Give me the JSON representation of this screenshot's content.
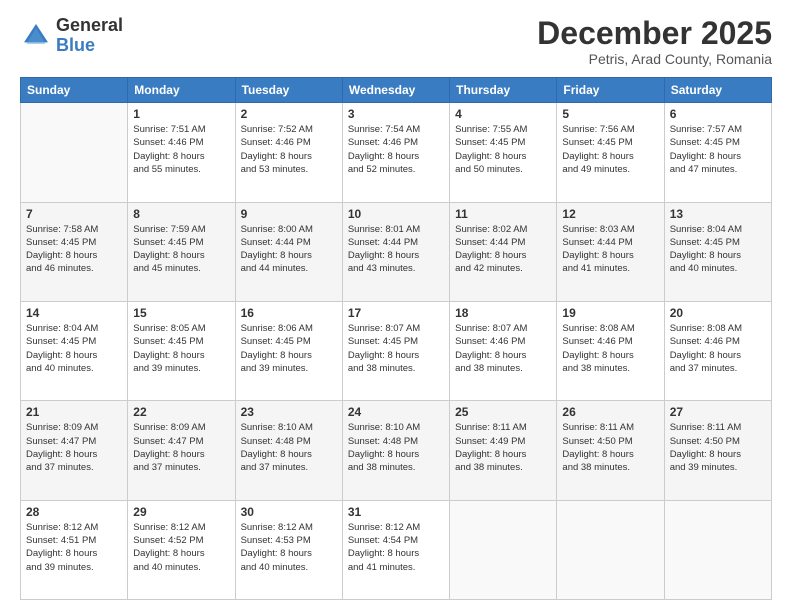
{
  "logo": {
    "general": "General",
    "blue": "Blue"
  },
  "title": "December 2025",
  "location": "Petris, Arad County, Romania",
  "days_header": [
    "Sunday",
    "Monday",
    "Tuesday",
    "Wednesday",
    "Thursday",
    "Friday",
    "Saturday"
  ],
  "weeks": [
    [
      {
        "day": "",
        "sunrise": "",
        "sunset": "",
        "daylight": ""
      },
      {
        "day": "1",
        "sunrise": "Sunrise: 7:51 AM",
        "sunset": "Sunset: 4:46 PM",
        "daylight": "Daylight: 8 hours and 55 minutes."
      },
      {
        "day": "2",
        "sunrise": "Sunrise: 7:52 AM",
        "sunset": "Sunset: 4:46 PM",
        "daylight": "Daylight: 8 hours and 53 minutes."
      },
      {
        "day": "3",
        "sunrise": "Sunrise: 7:54 AM",
        "sunset": "Sunset: 4:46 PM",
        "daylight": "Daylight: 8 hours and 52 minutes."
      },
      {
        "day": "4",
        "sunrise": "Sunrise: 7:55 AM",
        "sunset": "Sunset: 4:45 PM",
        "daylight": "Daylight: 8 hours and 50 minutes."
      },
      {
        "day": "5",
        "sunrise": "Sunrise: 7:56 AM",
        "sunset": "Sunset: 4:45 PM",
        "daylight": "Daylight: 8 hours and 49 minutes."
      },
      {
        "day": "6",
        "sunrise": "Sunrise: 7:57 AM",
        "sunset": "Sunset: 4:45 PM",
        "daylight": "Daylight: 8 hours and 47 minutes."
      }
    ],
    [
      {
        "day": "7",
        "sunrise": "Sunrise: 7:58 AM",
        "sunset": "Sunset: 4:45 PM",
        "daylight": "Daylight: 8 hours and 46 minutes."
      },
      {
        "day": "8",
        "sunrise": "Sunrise: 7:59 AM",
        "sunset": "Sunset: 4:45 PM",
        "daylight": "Daylight: 8 hours and 45 minutes."
      },
      {
        "day": "9",
        "sunrise": "Sunrise: 8:00 AM",
        "sunset": "Sunset: 4:44 PM",
        "daylight": "Daylight: 8 hours and 44 minutes."
      },
      {
        "day": "10",
        "sunrise": "Sunrise: 8:01 AM",
        "sunset": "Sunset: 4:44 PM",
        "daylight": "Daylight: 8 hours and 43 minutes."
      },
      {
        "day": "11",
        "sunrise": "Sunrise: 8:02 AM",
        "sunset": "Sunset: 4:44 PM",
        "daylight": "Daylight: 8 hours and 42 minutes."
      },
      {
        "day": "12",
        "sunrise": "Sunrise: 8:03 AM",
        "sunset": "Sunset: 4:44 PM",
        "daylight": "Daylight: 8 hours and 41 minutes."
      },
      {
        "day": "13",
        "sunrise": "Sunrise: 8:04 AM",
        "sunset": "Sunset: 4:45 PM",
        "daylight": "Daylight: 8 hours and 40 minutes."
      }
    ],
    [
      {
        "day": "14",
        "sunrise": "Sunrise: 8:04 AM",
        "sunset": "Sunset: 4:45 PM",
        "daylight": "Daylight: 8 hours and 40 minutes."
      },
      {
        "day": "15",
        "sunrise": "Sunrise: 8:05 AM",
        "sunset": "Sunset: 4:45 PM",
        "daylight": "Daylight: 8 hours and 39 minutes."
      },
      {
        "day": "16",
        "sunrise": "Sunrise: 8:06 AM",
        "sunset": "Sunset: 4:45 PM",
        "daylight": "Daylight: 8 hours and 39 minutes."
      },
      {
        "day": "17",
        "sunrise": "Sunrise: 8:07 AM",
        "sunset": "Sunset: 4:45 PM",
        "daylight": "Daylight: 8 hours and 38 minutes."
      },
      {
        "day": "18",
        "sunrise": "Sunrise: 8:07 AM",
        "sunset": "Sunset: 4:46 PM",
        "daylight": "Daylight: 8 hours and 38 minutes."
      },
      {
        "day": "19",
        "sunrise": "Sunrise: 8:08 AM",
        "sunset": "Sunset: 4:46 PM",
        "daylight": "Daylight: 8 hours and 38 minutes."
      },
      {
        "day": "20",
        "sunrise": "Sunrise: 8:08 AM",
        "sunset": "Sunset: 4:46 PM",
        "daylight": "Daylight: 8 hours and 37 minutes."
      }
    ],
    [
      {
        "day": "21",
        "sunrise": "Sunrise: 8:09 AM",
        "sunset": "Sunset: 4:47 PM",
        "daylight": "Daylight: 8 hours and 37 minutes."
      },
      {
        "day": "22",
        "sunrise": "Sunrise: 8:09 AM",
        "sunset": "Sunset: 4:47 PM",
        "daylight": "Daylight: 8 hours and 37 minutes."
      },
      {
        "day": "23",
        "sunrise": "Sunrise: 8:10 AM",
        "sunset": "Sunset: 4:48 PM",
        "daylight": "Daylight: 8 hours and 37 minutes."
      },
      {
        "day": "24",
        "sunrise": "Sunrise: 8:10 AM",
        "sunset": "Sunset: 4:48 PM",
        "daylight": "Daylight: 8 hours and 38 minutes."
      },
      {
        "day": "25",
        "sunrise": "Sunrise: 8:11 AM",
        "sunset": "Sunset: 4:49 PM",
        "daylight": "Daylight: 8 hours and 38 minutes."
      },
      {
        "day": "26",
        "sunrise": "Sunrise: 8:11 AM",
        "sunset": "Sunset: 4:50 PM",
        "daylight": "Daylight: 8 hours and 38 minutes."
      },
      {
        "day": "27",
        "sunrise": "Sunrise: 8:11 AM",
        "sunset": "Sunset: 4:50 PM",
        "daylight": "Daylight: 8 hours and 39 minutes."
      }
    ],
    [
      {
        "day": "28",
        "sunrise": "Sunrise: 8:12 AM",
        "sunset": "Sunset: 4:51 PM",
        "daylight": "Daylight: 8 hours and 39 minutes."
      },
      {
        "day": "29",
        "sunrise": "Sunrise: 8:12 AM",
        "sunset": "Sunset: 4:52 PM",
        "daylight": "Daylight: 8 hours and 40 minutes."
      },
      {
        "day": "30",
        "sunrise": "Sunrise: 8:12 AM",
        "sunset": "Sunset: 4:53 PM",
        "daylight": "Daylight: 8 hours and 40 minutes."
      },
      {
        "day": "31",
        "sunrise": "Sunrise: 8:12 AM",
        "sunset": "Sunset: 4:54 PM",
        "daylight": "Daylight: 8 hours and 41 minutes."
      },
      {
        "day": "",
        "sunrise": "",
        "sunset": "",
        "daylight": ""
      },
      {
        "day": "",
        "sunrise": "",
        "sunset": "",
        "daylight": ""
      },
      {
        "day": "",
        "sunrise": "",
        "sunset": "",
        "daylight": ""
      }
    ]
  ]
}
